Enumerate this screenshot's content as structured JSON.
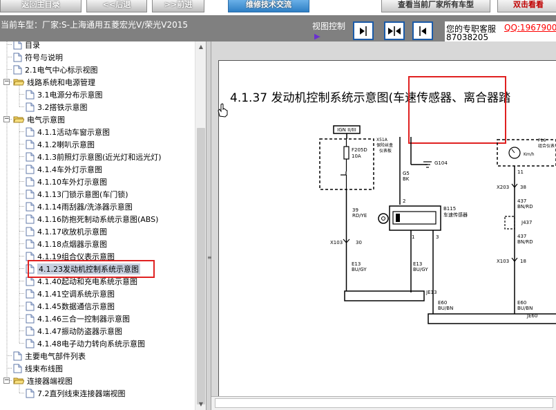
{
  "toolbar": {
    "home_label": "返回主目录",
    "back_label": "<<后退",
    "forward_label": ">>前进",
    "tech_label": "维修技术交流",
    "view_label": "查看当前厂家所有车型",
    "red_label": "双击看看"
  },
  "status": {
    "model_text": "当前车型：厂家:S-上海通用五菱宏光V/荣光V2015",
    "view_control_label": "视图控制",
    "service_label": "您的专职客服",
    "service_qq": "QQ:1967900",
    "service_number": "87038205"
  },
  "tree": {
    "items": [
      {
        "label": "目录",
        "type": "page",
        "indent": 1
      },
      {
        "label": "符号与说明",
        "type": "page",
        "indent": 1
      },
      {
        "label": "2.1电气中心标示视图",
        "type": "page",
        "indent": 1
      },
      {
        "label": "线路系统和电源管理",
        "type": "folder",
        "indent": 1,
        "expanded": true
      },
      {
        "label": "3.1电源分布示意图",
        "type": "page",
        "indent": 2
      },
      {
        "label": "3.2搭铁示意图",
        "type": "page",
        "indent": 2
      },
      {
        "label": "电气示意图",
        "type": "folder",
        "indent": 1,
        "expanded": true
      },
      {
        "label": "4.1.1活动车窗示意图",
        "type": "page",
        "indent": 2
      },
      {
        "label": "4.1.2喇叭示意图",
        "type": "page",
        "indent": 2
      },
      {
        "label": "4.1.3前照灯示意图(近光灯和远光灯)",
        "type": "page",
        "indent": 2
      },
      {
        "label": "4.1.4车外灯示意图",
        "type": "page",
        "indent": 2
      },
      {
        "label": "4.1.10车外灯示意图",
        "type": "page",
        "indent": 2
      },
      {
        "label": "4.1.13门锁示意图(车门锁)",
        "type": "page",
        "indent": 2
      },
      {
        "label": "4.1.14雨刮器/洗涤器示意图",
        "type": "page",
        "indent": 2
      },
      {
        "label": "4.1.16防抱死制动系统示意图(ABS)",
        "type": "page",
        "indent": 2
      },
      {
        "label": "4.1.17收放机示意图",
        "type": "page",
        "indent": 2
      },
      {
        "label": "4.1.18点烟器示意图",
        "type": "page",
        "indent": 2
      },
      {
        "label": "4.1.19组合仪表示意图",
        "type": "page",
        "indent": 2
      },
      {
        "label": "4.1.23发动机控制系统示意图",
        "type": "page",
        "indent": 2,
        "selected": true
      },
      {
        "label": "4.1.40起动和充电系统示意图",
        "type": "page",
        "indent": 2
      },
      {
        "label": "4.1.41空调系统示意图",
        "type": "page",
        "indent": 2
      },
      {
        "label": "4.1.45数据通信示意图",
        "type": "page",
        "indent": 2
      },
      {
        "label": "4.1.46三合一控制器示意图",
        "type": "page",
        "indent": 2
      },
      {
        "label": "4.1.47振动防盗器示意图",
        "type": "page",
        "indent": 2
      },
      {
        "label": "4.1.48电子动力转向系统示意图",
        "type": "page",
        "indent": 2
      },
      {
        "label": "主要电气部件列表",
        "type": "page",
        "indent": 1
      },
      {
        "label": "线束布线图",
        "type": "page",
        "indent": 1
      },
      {
        "label": "连接器端视图",
        "type": "folder",
        "indent": 1,
        "expanded": true
      },
      {
        "label": "7.2直列线束连接器端视图",
        "type": "page",
        "indent": 2
      }
    ]
  },
  "document": {
    "title": "4.1.37 发动机控制系统示意图(车速传感器、离合器踏",
    "schematic_labels": {
      "ign": "IGN II/III",
      "x51a": "X51A",
      "x51a_desc1": "保险丝盒",
      "x51a_desc2": "仪表板",
      "fuse": "F205D",
      "fuse_amp": "10A",
      "g5": "G5",
      "bk": "BK",
      "g104": "G104",
      "p16": "P16",
      "p16_desc": "组合仪表",
      "kmh": "Km/h",
      "w39": "39",
      "rdye": "RD/YE",
      "pin2": "2",
      "b115": "B115",
      "b115_desc": "车速传感器",
      "pin1": "1",
      "pin3": "3",
      "x103a": "X103",
      "p30": "30",
      "e13a": "E13",
      "bugy_a": "BU/GY",
      "e13b": "E13",
      "bugy_b": "BU/GY",
      "je13": "JE13",
      "e60a": "E60",
      "bubn_a": "BU/BN",
      "pin11": "11",
      "x203": "X203",
      "p38": "38",
      "w437a": "437",
      "bnrd_a": "BN/RD",
      "j437": "J437",
      "w437b": "437",
      "bnrd_b": "BN/RD",
      "x103b": "X103",
      "p18": "18",
      "e60b": "E60",
      "bubn_b": "BU/BN",
      "je60": "JE60"
    }
  }
}
